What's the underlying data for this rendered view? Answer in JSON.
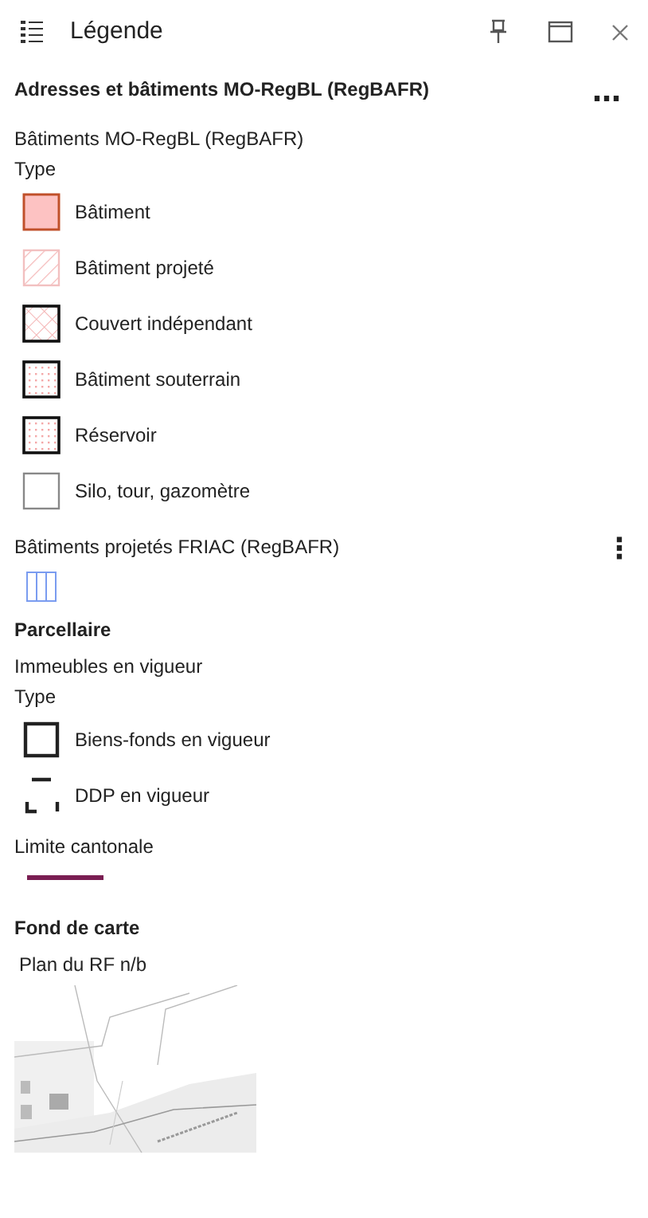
{
  "panel": {
    "title": "Légende"
  },
  "sections": [
    {
      "title": "Adresses et bâtiments MO-RegBL (RegBAFR)",
      "menu": "⋯",
      "layers": [
        {
          "name": "Bâtiments MO-RegBL (RegBAFR)",
          "type_label": "Type",
          "items": [
            {
              "label": "Bâtiment",
              "kind": "solid"
            },
            {
              "label": "Bâtiment projeté",
              "kind": "hatch"
            },
            {
              "label": "Couvert indépendant",
              "kind": "cross"
            },
            {
              "label": "Bâtiment souterrain",
              "kind": "dots"
            },
            {
              "label": "Réservoir",
              "kind": "dots"
            },
            {
              "label": "Silo, tour, gazomètre",
              "kind": "plain"
            }
          ]
        },
        {
          "name": "Bâtiments projetés FRIAC (RegBAFR)",
          "menu": "⋮",
          "items": [
            {
              "kind": "stripes"
            }
          ]
        }
      ]
    },
    {
      "title": "Parcellaire",
      "layers": [
        {
          "name": "Immeubles en vigueur",
          "type_label": "Type",
          "items": [
            {
              "label": "Biens-fonds en vigueur",
              "kind": "outline"
            },
            {
              "label": "DDP en vigueur",
              "kind": "dashed"
            }
          ]
        },
        {
          "name": "Limite cantonale",
          "items": [
            {
              "kind": "line"
            }
          ]
        }
      ]
    },
    {
      "title": "Fond de carte",
      "layers": [
        {
          "name": "Plan du RF n/b"
        }
      ]
    }
  ]
}
